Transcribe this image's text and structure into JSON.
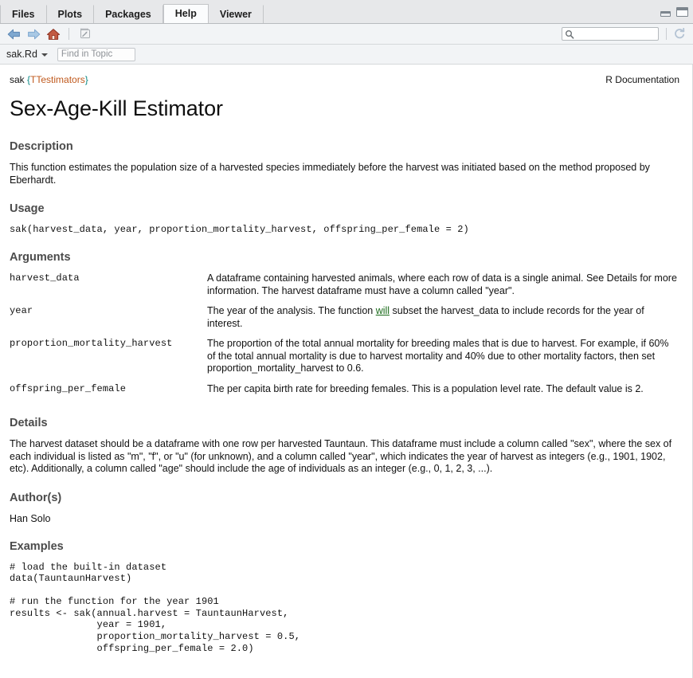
{
  "window": {
    "tabs": [
      {
        "label": "Files",
        "active": false
      },
      {
        "label": "Plots",
        "active": false
      },
      {
        "label": "Packages",
        "active": false
      },
      {
        "label": "Help",
        "active": true
      },
      {
        "label": "Viewer",
        "active": false
      }
    ],
    "minimize_label": "Minimize",
    "maximize_label": "Maximize"
  },
  "toolbar": {
    "back_label": "Back",
    "forward_label": "Forward",
    "home_label": "Home",
    "popout_label": "Show in new window",
    "search_value": "",
    "search_placeholder": "",
    "refresh_label": "Refresh"
  },
  "findbar": {
    "topic_file": "sak.Rd",
    "find_value": "",
    "find_placeholder": "Find in Topic"
  },
  "doc": {
    "header_func": "sak",
    "header_brace_open": " {",
    "header_package": "TTestimators",
    "header_brace_close": "}",
    "header_right": "R Documentation",
    "title": "Sex-Age-Kill Estimator",
    "sections": {
      "description_heading": "Description",
      "description_text": "This function estimates the population size of a harvested species immediately before the harvest was initiated based on the method proposed by Eberhardt.",
      "usage_heading": "Usage",
      "usage_code": "sak(harvest_data, year, proportion_mortality_harvest, offspring_per_female = 2)",
      "arguments_heading": "Arguments",
      "details_heading": "Details",
      "details_text": "The harvest dataset should be a dataframe with one row per harvested Tauntaun. This dataframe must include a column called \"sex\", where the sex of each individual is listed as \"m\", \"f\", or \"u\" (for unknown), and a column called \"year\", which indicates the year of harvest as integers (e.g., 1901, 1902, etc). Additionally, a column called \"age\" should include the age of individuals as an integer (e.g., 0, 1, 2, 3, ...).",
      "author_heading": "Author(s)",
      "author_text": "Han Solo",
      "examples_heading": "Examples",
      "examples_code": "# load the built-in dataset\ndata(TauntaunHarvest)\n\n# run the function for the year 1901\nresults <- sak(annual.harvest = TauntaunHarvest,\n               year = 1901,\n               proportion_mortality_harvest = 0.5,\n               offspring_per_female = 2.0)"
    },
    "arguments": [
      {
        "name": "harvest_data",
        "desc": "A dataframe containing harvested animals, where each row of data is a single animal. See Details for more information. The harvest dataframe must have a column called \"year\"."
      },
      {
        "name": "year",
        "desc_pre": "The year of the analysis. The function ",
        "desc_link": "will",
        "desc_post": " subset the harvest_data to include records for the year of interest."
      },
      {
        "name": "proportion_mortality_harvest",
        "desc": "The proportion of the total annual mortality for breeding males that is due to harvest. For example, if 60% of the total annual mortality is due to harvest mortality and 40% due to other mortality factors, then set proportion_mortality_harvest to 0.6."
      },
      {
        "name": "offspring_per_female",
        "desc": "The per capita birth rate for breeding females. This is a population level rate. The default value is 2."
      }
    ]
  },
  "colors": {
    "tab_active_bg": "#fbfcfd",
    "tab_bg": "#e7e8ea",
    "panel_bg": "#f2f4f6",
    "heading_gray": "#4b4b4b",
    "link_green": "#1a6b1a",
    "package_orange": "#c05a1e",
    "brace_teal": "#0f8a86",
    "home_icon_red": "#b03a2e",
    "arrow_blue": "#7fa8d0"
  }
}
